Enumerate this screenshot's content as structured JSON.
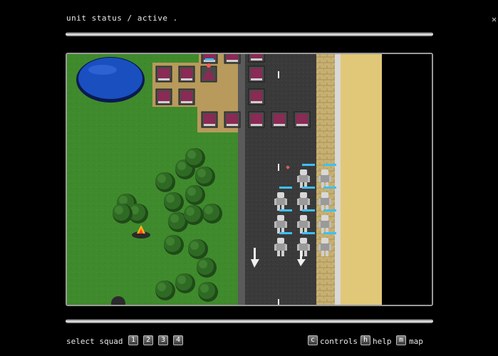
{
  "header": {
    "status_text": "unit status / active",
    "dot": "."
  },
  "corner_icon": "close-icon",
  "footer": {
    "select_squad_label": "select squad",
    "squads": [
      "1",
      "2",
      "3",
      "4"
    ],
    "controls": {
      "key": "c",
      "label": "controls"
    },
    "help": {
      "key": "h",
      "label": "help"
    },
    "map": {
      "key": "m",
      "label": "map"
    }
  },
  "colors": {
    "grass": "#3f8a2c",
    "road": "#3a3a3a",
    "sand": "#e0c878",
    "water": "#1a4fc0",
    "health_bar": "#3cc0ff"
  }
}
